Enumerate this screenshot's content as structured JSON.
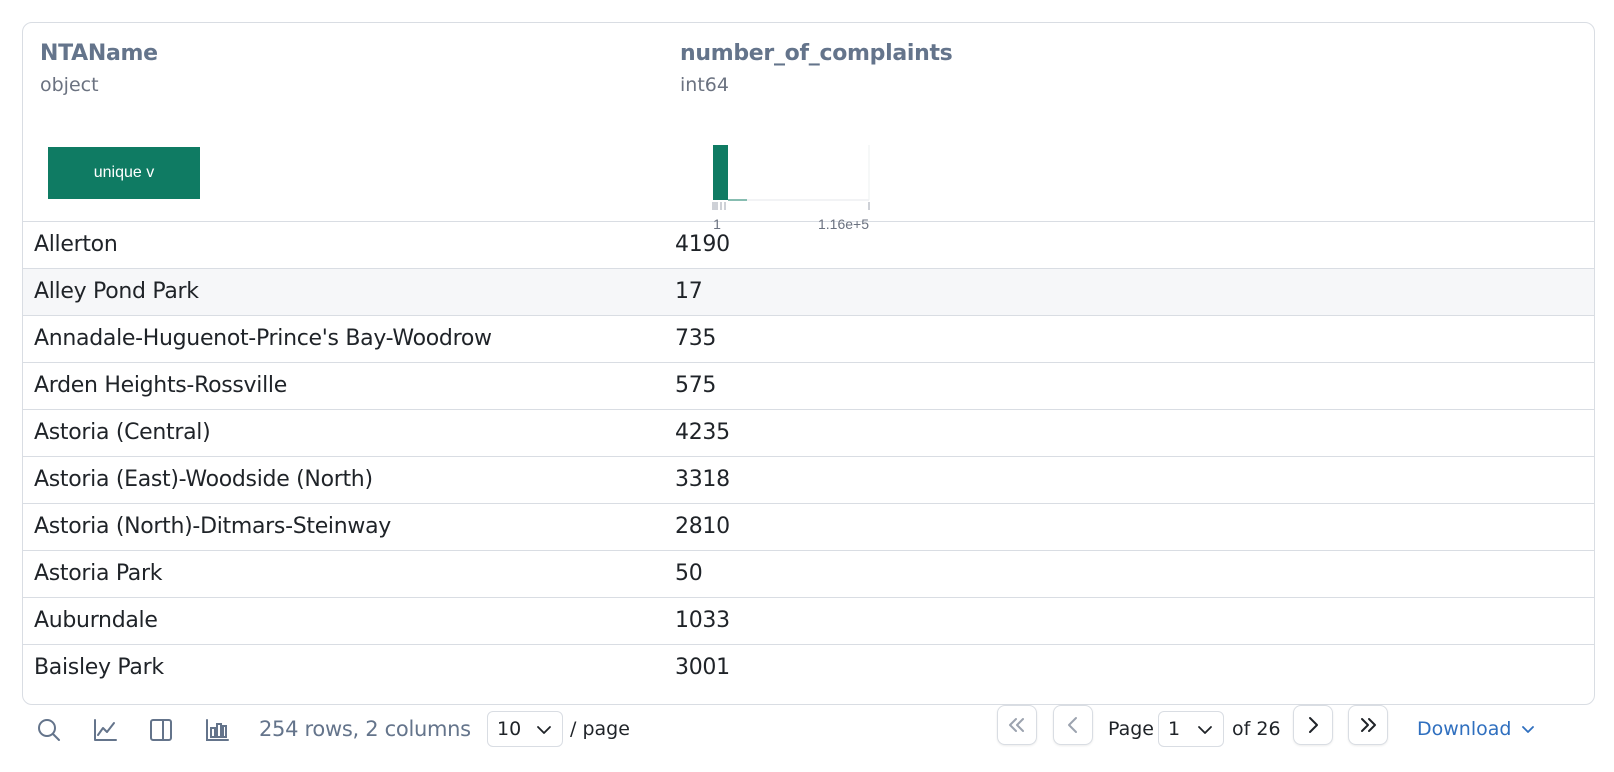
{
  "columns": [
    {
      "name": "NTAName",
      "dtype": "object",
      "summary_label": "unique v"
    },
    {
      "name": "number_of_complaints",
      "dtype": "int64",
      "histogram": {
        "min_label": "1",
        "max_label": "1.16e+5"
      }
    }
  ],
  "rows": [
    {
      "NTAName": "Allerton",
      "number_of_complaints": "4190"
    },
    {
      "NTAName": "Alley Pond Park",
      "number_of_complaints": "17"
    },
    {
      "NTAName": "Annadale-Huguenot-Prince's Bay-Woodrow",
      "number_of_complaints": "735"
    },
    {
      "NTAName": "Arden Heights-Rossville",
      "number_of_complaints": "575"
    },
    {
      "NTAName": "Astoria (Central)",
      "number_of_complaints": "4235"
    },
    {
      "NTAName": "Astoria (East)-Woodside (North)",
      "number_of_complaints": "3318"
    },
    {
      "NTAName": "Astoria (North)-Ditmars-Steinway",
      "number_of_complaints": "2810"
    },
    {
      "NTAName": "Astoria Park",
      "number_of_complaints": "50"
    },
    {
      "NTAName": "Auburndale",
      "number_of_complaints": "1033"
    },
    {
      "NTAName": "Baisley Park",
      "number_of_complaints": "3001"
    }
  ],
  "footer": {
    "icons": [
      "search-icon",
      "line-chart-icon",
      "panel-icon",
      "bar-chart-icon"
    ],
    "rows_info": "254 rows, 2 columns",
    "page_size": "10",
    "per_page_label": "/ page",
    "page_label": "Page",
    "current_page": "1",
    "of_label": "of 26",
    "download_label": "Download"
  },
  "colors": {
    "accent": "#0f7b63",
    "link": "#2f6fbf",
    "border": "#d9dde3",
    "muted": "#64748b"
  }
}
